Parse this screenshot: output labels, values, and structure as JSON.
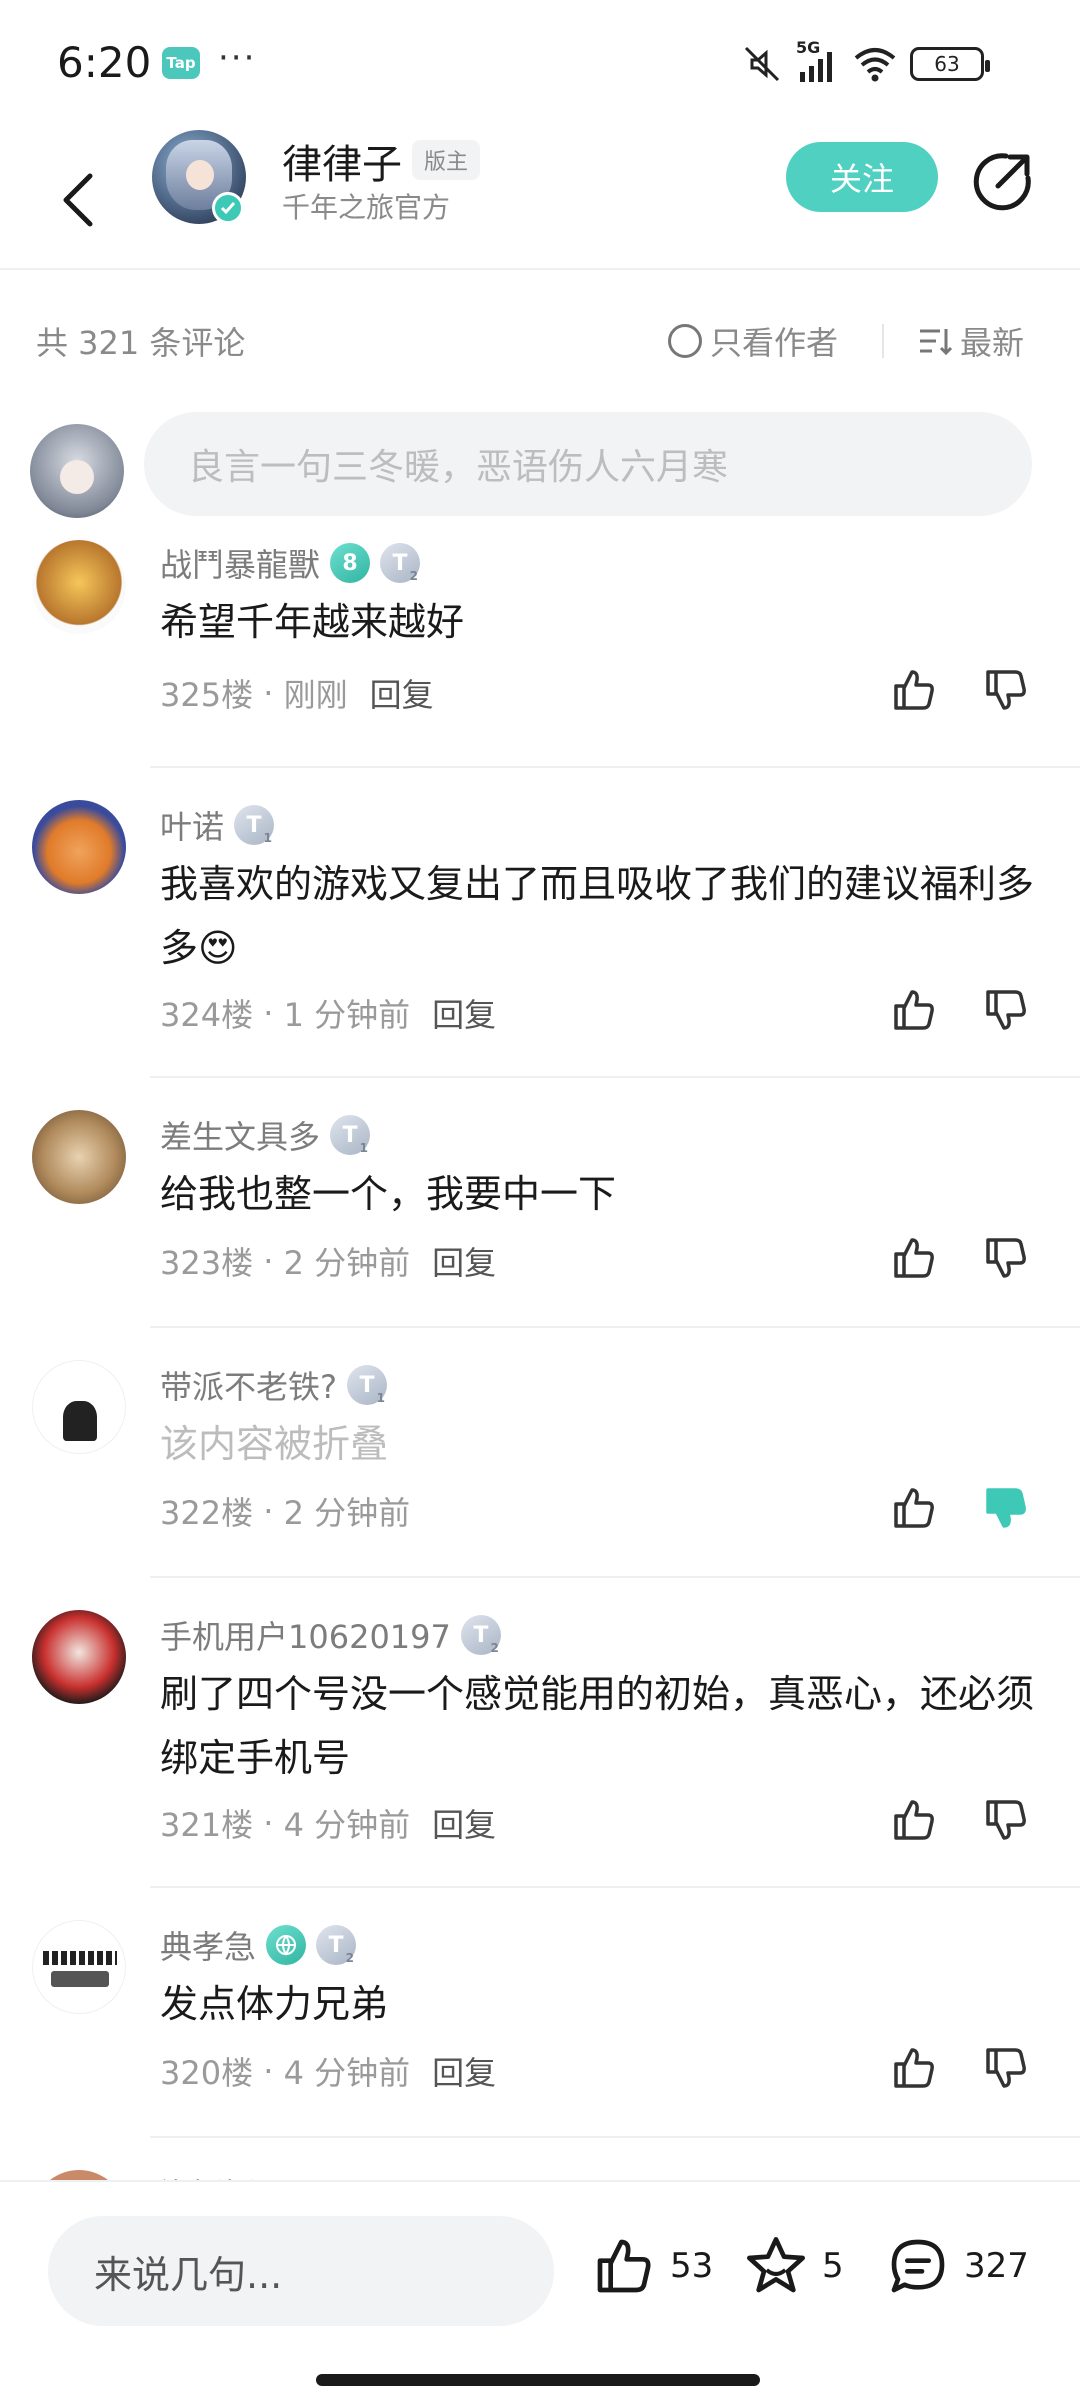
{
  "status_bar": {
    "time": "6:20",
    "app_badge": "Tap",
    "more": "···",
    "network": "5G",
    "battery": "63"
  },
  "header": {
    "author_name": "律律子",
    "role_badge": "版主",
    "author_subtitle": "千年之旅官方",
    "follow_label": "关注"
  },
  "comments_bar": {
    "count_text": "共 321 条评论",
    "only_author_label": "只看作者",
    "sort_label": "最新"
  },
  "input": {
    "placeholder": "良言一句三冬暖，恶语伤人六月寒"
  },
  "comments": [
    {
      "user": "战鬥暴龍獸",
      "badges": [
        "8",
        "T2"
      ],
      "text": "希望千年越来越好",
      "floor": "325楼",
      "time": "刚刚",
      "reply": "回复",
      "folded": false,
      "disliked": false
    },
    {
      "user": "叶诺",
      "badges": [
        "T1"
      ],
      "text": "我喜欢的游戏又复出了而且吸收了我们的建议福利多多😍",
      "floor": "324楼",
      "time": "1 分钟前",
      "reply": "回复",
      "folded": false,
      "disliked": false
    },
    {
      "user": "差生文具多",
      "badges": [
        "T1"
      ],
      "text": "给我也整一个，我要中一下",
      "floor": "323楼",
      "time": "2 分钟前",
      "reply": "回复",
      "folded": false,
      "disliked": false
    },
    {
      "user": "带派不老铁?",
      "badges": [
        "T1"
      ],
      "text": "该内容被折叠",
      "floor": "322楼",
      "time": "2 分钟前",
      "reply": "",
      "folded": true,
      "disliked": true
    },
    {
      "user": "手机用户10620197",
      "badges": [
        "T2"
      ],
      "text": "刷了四个号没一个感觉能用的初始，真恶心，还必须绑定手机号",
      "floor": "321楼",
      "time": "4 分钟前",
      "reply": "回复",
      "folded": false,
      "disliked": false
    },
    {
      "user": "典孝急",
      "badges": [
        "globe",
        "T2"
      ],
      "text": "发点体力兄弟",
      "floor": "320楼",
      "time": "4 分钟前",
      "reply": "回复",
      "folded": false,
      "disliked": false
    }
  ],
  "partial_comment": {
    "user": "泡饭饭"
  },
  "bottom_bar": {
    "input_placeholder": "来说几句...",
    "likes": "53",
    "favorites": "5",
    "comments": "327"
  },
  "colors": {
    "accent": "#4fd0c0",
    "text": "#1a1a1a",
    "muted": "#9a9a9a",
    "input_bg": "#f2f3f5"
  }
}
